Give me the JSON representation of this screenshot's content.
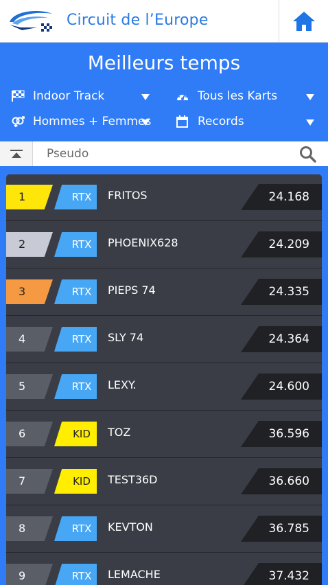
{
  "header": {
    "title": "Circuit de l’Europe",
    "logo_icon": "circuit-logo-icon",
    "home_icon": "home-icon"
  },
  "panel": {
    "title": "Meilleurs temps",
    "filters": [
      {
        "icon": "checkered-flag-icon",
        "label": "Indoor Track"
      },
      {
        "icon": "speedometer-icon",
        "label": "Tous les Karts"
      },
      {
        "icon": "gender-icon",
        "label": "Hommes + Femmes"
      },
      {
        "icon": "calendar-icon",
        "label": "Records"
      }
    ]
  },
  "search": {
    "placeholder": "Pseudo",
    "collapse_icon": "collapse-up-icon",
    "search_icon": "search-icon"
  },
  "leaderboard": [
    {
      "rank": "1",
      "kart": "RTX",
      "name": "FRITOS",
      "time": "24.168"
    },
    {
      "rank": "2",
      "kart": "RTX",
      "name": "PHOENIX628",
      "time": "24.209"
    },
    {
      "rank": "3",
      "kart": "RTX",
      "name": "PIEPS 74",
      "time": "24.335"
    },
    {
      "rank": "4",
      "kart": "RTX",
      "name": "SLY 74",
      "time": "24.364"
    },
    {
      "rank": "5",
      "kart": "RTX",
      "name": "LEXY.",
      "time": "24.600"
    },
    {
      "rank": "6",
      "kart": "KID",
      "name": "TOZ",
      "time": "36.596"
    },
    {
      "rank": "7",
      "kart": "KID",
      "name": "TEST36D",
      "time": "36.660"
    },
    {
      "rank": "8",
      "kart": "RTX",
      "name": "KEVTON",
      "time": "36.785"
    },
    {
      "rank": "9",
      "kart": "RTX",
      "name": "LEMACHE",
      "time": "37.432"
    }
  ],
  "colors": {
    "brand_blue": "#2f7cf6",
    "gold": "#ffe60a",
    "silver": "#c8cad6",
    "bronze": "#f59a42",
    "rtx": "#47a7f5",
    "kid": "#ffee00"
  }
}
